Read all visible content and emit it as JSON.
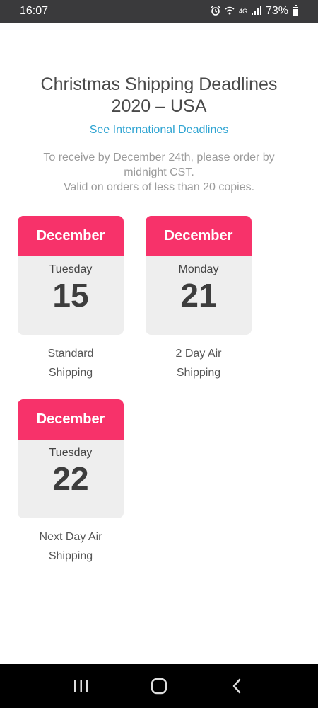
{
  "status_bar": {
    "time": "16:07",
    "network": "4G",
    "battery": "73%"
  },
  "page": {
    "title_line1": "Christmas Shipping Deadlines",
    "title_line2": "2020 – USA",
    "international_link": "See International Deadlines",
    "note_line1": "To receive by December 24th, please order by midnight CST.",
    "note_line2": "Valid on orders of less than 20 copies."
  },
  "deadlines": [
    {
      "month": "December",
      "weekday": "Tuesday",
      "date": "15",
      "label_line1": "Standard",
      "label_line2": "Shipping"
    },
    {
      "month": "December",
      "weekday": "Monday",
      "date": "21",
      "label_line1": "2 Day Air",
      "label_line2": "Shipping"
    },
    {
      "month": "December",
      "weekday": "Tuesday",
      "date": "22",
      "label_line1": "Next Day Air",
      "label_line2": "Shipping"
    }
  ],
  "colors": {
    "accent": "#f7326a",
    "link": "#2fa4d2",
    "card_bg": "#eeeeee"
  },
  "nav_icons": [
    "recent-apps-icon",
    "home-icon",
    "back-icon"
  ]
}
